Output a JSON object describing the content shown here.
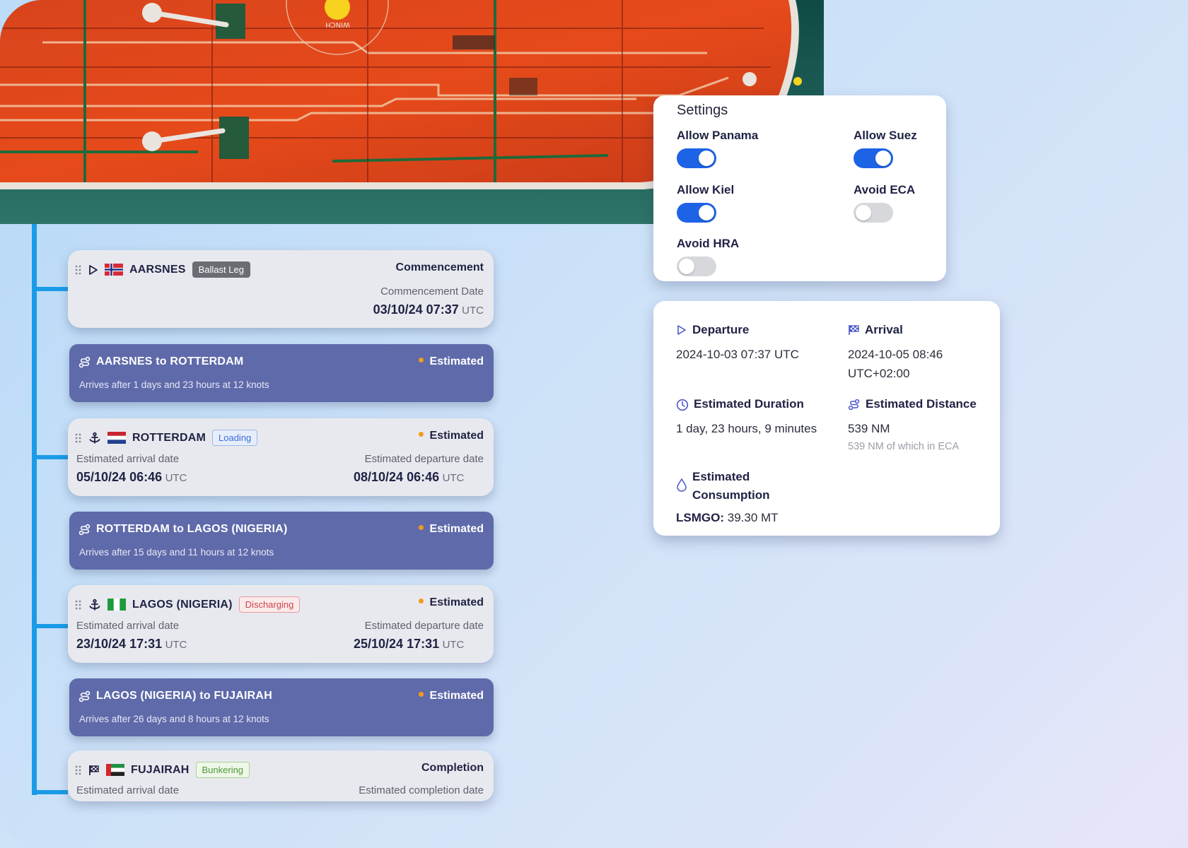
{
  "settings": {
    "title": "Settings",
    "options": [
      {
        "label": "Allow Panama",
        "on": true
      },
      {
        "label": "Allow Suez",
        "on": true
      },
      {
        "label": "Allow Kiel",
        "on": true
      },
      {
        "label": "Avoid ECA",
        "on": false
      },
      {
        "label": "Avoid HRA",
        "on": false
      }
    ]
  },
  "summary": {
    "departure": {
      "label": "Departure",
      "value": "2024-10-03 07:37 UTC"
    },
    "arrival": {
      "label": "Arrival",
      "value_line1": "2024-10-05 08:46",
      "value_line2": "UTC+02:00"
    },
    "duration": {
      "label": "Estimated Duration",
      "value": "1 day, 23 hours, 9 minutes"
    },
    "distance": {
      "label": "Estimated Distance",
      "value": "539 NM",
      "note": "539 NM of which in ECA"
    },
    "consumption": {
      "label_line1": "Estimated",
      "label_line2": "Consumption",
      "fuel": "LSMGO:",
      "amount": "39.30 MT"
    }
  },
  "timeline": {
    "commencement": {
      "port": "AARSNES",
      "badge": "Ballast Leg",
      "status": "Commencement",
      "date_label": "Commencement Date",
      "date": "03/10/24 07:37",
      "tz": "UTC"
    },
    "leg1": {
      "title": "AARSNES to ROTTERDAM",
      "status": "Estimated",
      "sub": "Arrives after 1 days and 23 hours at 12 knots"
    },
    "rotterdam": {
      "port": "ROTTERDAM",
      "badge": "Loading",
      "status": "Estimated",
      "arr_label": "Estimated arrival date",
      "arr": "05/10/24 06:46",
      "dep_label": "Estimated departure date",
      "dep": "08/10/24 06:46",
      "tz": "UTC"
    },
    "leg2": {
      "title": "ROTTERDAM to LAGOS (NIGERIA)",
      "status": "Estimated",
      "sub": "Arrives after 15 days and 11 hours at 12 knots"
    },
    "lagos": {
      "port": "LAGOS (NIGERIA)",
      "badge": "Discharging",
      "status": "Estimated",
      "arr_label": "Estimated arrival date",
      "arr": "23/10/24 17:31",
      "dep_label": "Estimated departure date",
      "dep": "25/10/24 17:31",
      "tz": "UTC"
    },
    "leg3": {
      "title": "LAGOS (NIGERIA) to FUJAIRAH",
      "status": "Estimated",
      "sub": "Arrives after 26 days and 8 hours at 12 knots"
    },
    "fujairah": {
      "port": "FUJAIRAH",
      "badge": "Bunkering",
      "status": "Completion",
      "arr_label": "Estimated arrival date",
      "comp_label": "Estimated completion date"
    }
  },
  "colors": {
    "accent": "#1d63e6",
    "leg": "#5f6aaa",
    "timeline": "#1a9be8",
    "estimated_dot": "#f39a1e"
  }
}
